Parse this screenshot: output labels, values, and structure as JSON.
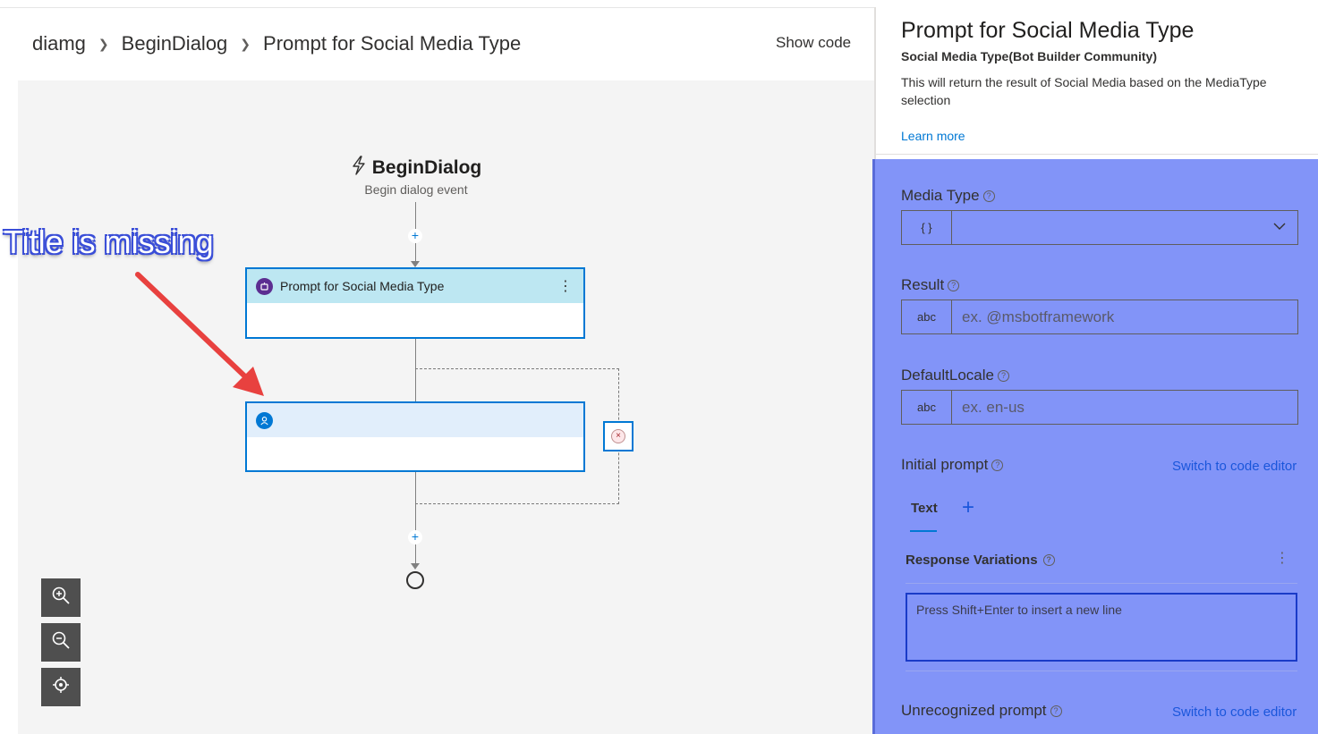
{
  "breadcrumb": {
    "items": [
      "diamg",
      "BeginDialog",
      "Prompt for Social Media Type"
    ]
  },
  "header": {
    "show_code": "Show code"
  },
  "canvas": {
    "trigger_title": "BeginDialog",
    "trigger_subtitle": "Begin dialog event",
    "node1_title": "Prompt for Social Media Type",
    "node2_title": "",
    "plus_symbol": "+"
  },
  "annotation": {
    "text": "Title is missing"
  },
  "panel": {
    "title": "Prompt for Social Media Type",
    "subtitle": "Social Media Type(Bot Builder Community)",
    "description": "This will return the result of Social Media based on the MediaType selection",
    "learn_more": "Learn more"
  },
  "form": {
    "media_type": {
      "label": "Media Type",
      "type_badge": "{ }",
      "value": ""
    },
    "result": {
      "label": "Result",
      "type_badge": "abc",
      "placeholder": "ex. @msbotframework"
    },
    "default_locale": {
      "label": "DefaultLocale",
      "type_badge": "abc",
      "placeholder": "ex. en-us"
    },
    "initial_prompt": {
      "label": "Initial prompt",
      "switch_link": "Switch to code editor",
      "tab_text": "Text",
      "tab_add": "+",
      "response_variations": "Response Variations",
      "response_placeholder": "Press Shift+Enter to insert a new line"
    },
    "unrecognized_prompt": {
      "label": "Unrecognized prompt",
      "switch_link": "Switch to code editor"
    }
  },
  "colors": {
    "accent": "#0078d4",
    "node1_header": "#bde7f2",
    "node2_header": "#e1eefb",
    "form_highlight": "#8294f8",
    "canvas_bg": "#f4f4f4"
  },
  "icons": [
    "chevron-right-icon",
    "lightning-icon",
    "bot-icon",
    "user-icon",
    "more-icon",
    "error-icon",
    "zoom-in-icon",
    "zoom-out-icon",
    "fit-icon",
    "help-icon",
    "chevron-down-icon"
  ]
}
